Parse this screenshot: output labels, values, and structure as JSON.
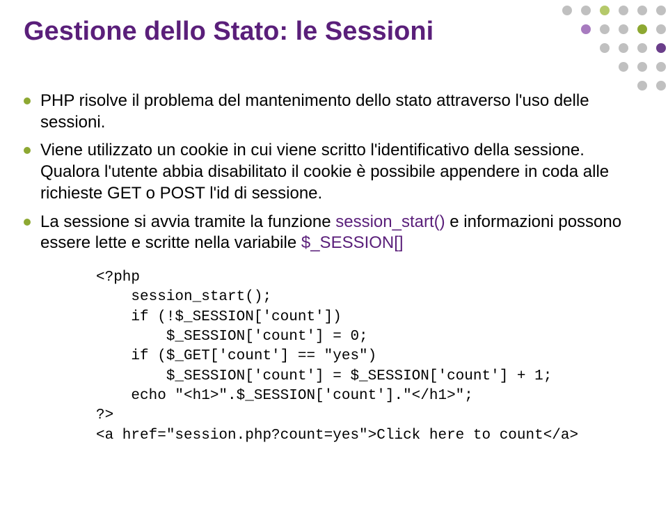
{
  "title": "Gestione dello Stato: le Sessioni",
  "bullets": {
    "b1": "PHP risolve il problema del mantenimento dello stato attraverso l'uso delle sessioni.",
    "b2": "Viene utilizzato un cookie in cui viene scritto l'identificativo della sessione. Qualora l'utente abbia disabilitato il cookie è possibile appendere in coda alle richieste GET o POST l'id di sessione.",
    "b3_part1": "La sessione si avvia tramite la funzione ",
    "b3_accent1": "session_start()",
    "b3_part2": " e informazioni possono essere lette e scritte nella variabile ",
    "b3_accent2": "$_SESSION[]"
  },
  "code": {
    "l1": "<?php",
    "l2": "    session_start();",
    "l3": "    if (!$_SESSION['count'])",
    "l4": "        $_SESSION['count'] = 0;",
    "l5": "    if ($_GET['count'] == \"yes\")",
    "l6": "        $_SESSION['count'] = $_SESSION['count'] + 1;",
    "l7": "    echo \"<h1>\".$_SESSION['count'].\"</h1>\";",
    "l8": "?>",
    "l9": "<a href=\"session.php?count=yes\">Click here to count</a>"
  }
}
